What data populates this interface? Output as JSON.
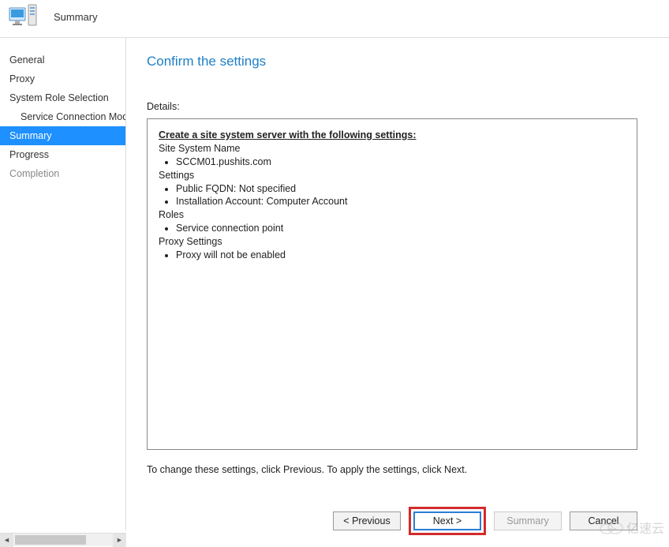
{
  "header": {
    "title": "Summary"
  },
  "nav": {
    "items": [
      {
        "label": "General",
        "indent": false,
        "selected": false,
        "disabled": false
      },
      {
        "label": "Proxy",
        "indent": false,
        "selected": false,
        "disabled": false
      },
      {
        "label": "System Role Selection",
        "indent": false,
        "selected": false,
        "disabled": false
      },
      {
        "label": "Service Connection Mode",
        "indent": true,
        "selected": false,
        "disabled": false
      },
      {
        "label": "Summary",
        "indent": false,
        "selected": true,
        "disabled": false
      },
      {
        "label": "Progress",
        "indent": false,
        "selected": false,
        "disabled": false
      },
      {
        "label": "Completion",
        "indent": false,
        "selected": false,
        "disabled": true
      }
    ]
  },
  "main": {
    "title": "Confirm the settings",
    "details_label": "Details:",
    "details": {
      "heading": "Create a site system server with the following settings:",
      "sections": [
        {
          "label": "Site System Name",
          "items": [
            "SCCM01.pushits.com"
          ]
        },
        {
          "label": "Settings",
          "items": [
            "Public FQDN: Not specified",
            "Installation Account: Computer Account"
          ]
        },
        {
          "label": "Roles",
          "items": [
            "Service connection point"
          ]
        },
        {
          "label": "Proxy Settings",
          "items": [
            "Proxy will not be enabled"
          ]
        }
      ]
    },
    "instruction": "To change these settings, click Previous. To apply the settings, click Next."
  },
  "buttons": {
    "previous": "< Previous",
    "next": "Next >",
    "summary": "Summary",
    "cancel": "Cancel"
  },
  "watermark": "亿速云"
}
